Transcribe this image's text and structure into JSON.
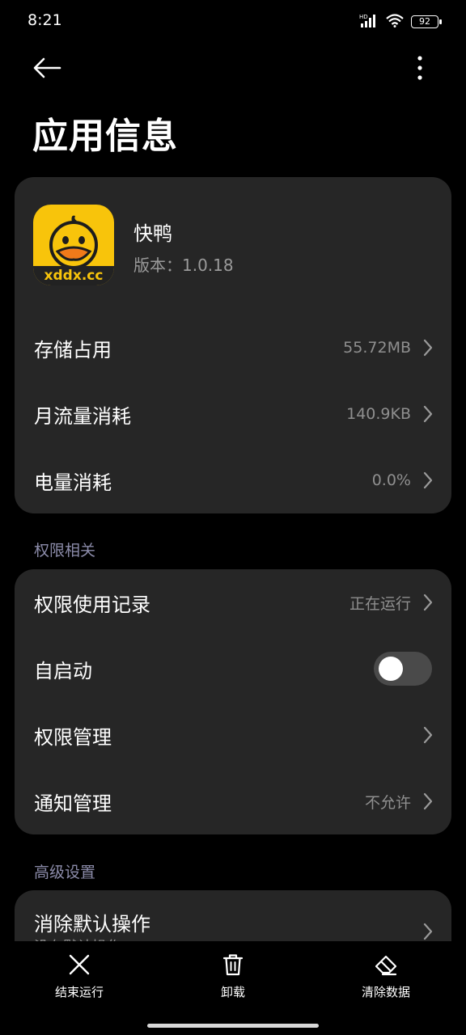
{
  "status": {
    "time": "8:21",
    "battery": "92",
    "network": "HD"
  },
  "page": {
    "title": "应用信息"
  },
  "app": {
    "name": "快鸭",
    "version": "版本：1.0.18",
    "icon_text": "xddx.cc",
    "icon_color": "#f8c40b"
  },
  "usage_rows": [
    {
      "label": "存储占用",
      "value": "55.72MB"
    },
    {
      "label": "月流量消耗",
      "value": "140.9KB"
    },
    {
      "label": "电量消耗",
      "value": "0.0%"
    }
  ],
  "permission_section": {
    "header": "权限相关",
    "rows": [
      {
        "label": "权限使用记录",
        "value": "正在运行"
      },
      {
        "label": "自启动",
        "toggle": false
      },
      {
        "label": "权限管理",
        "value": ""
      },
      {
        "label": "通知管理",
        "value": "不允许"
      }
    ]
  },
  "advanced_section": {
    "header": "高级设置",
    "rows": [
      {
        "label": "消除默认操作",
        "sub": "没有默认操作"
      }
    ]
  },
  "bottom_actions": [
    {
      "label": "结束运行",
      "icon": "close-icon"
    },
    {
      "label": "卸载",
      "icon": "trash-icon"
    },
    {
      "label": "清除数据",
      "icon": "eraser-icon"
    }
  ]
}
